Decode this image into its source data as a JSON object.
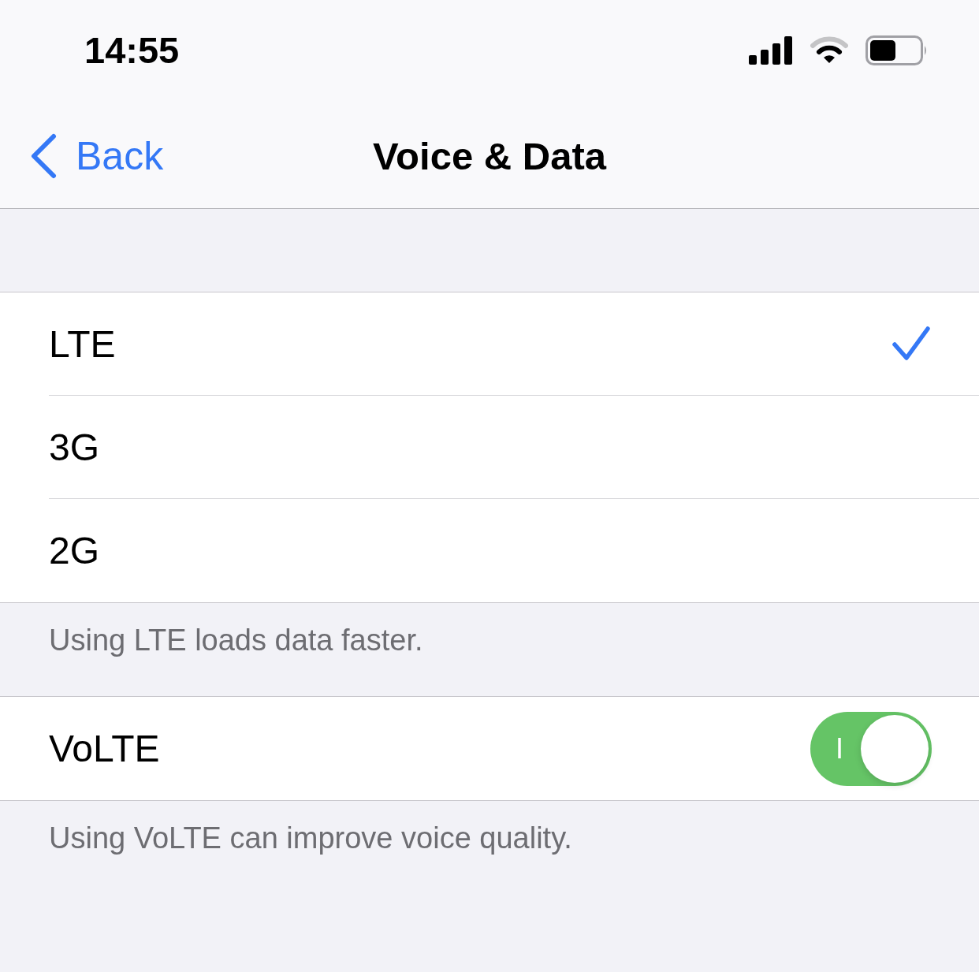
{
  "status_bar": {
    "time": "14:55"
  },
  "nav": {
    "back_label": "Back",
    "title": "Voice & Data"
  },
  "network_options": [
    {
      "label": "LTE",
      "selected": true
    },
    {
      "label": "3G",
      "selected": false
    },
    {
      "label": "2G",
      "selected": false
    }
  ],
  "network_footer": "Using LTE loads data faster.",
  "volte": {
    "label": "VoLTE",
    "on": true,
    "switch_label": "I"
  },
  "volte_footer": "Using VoLTE can improve voice quality."
}
